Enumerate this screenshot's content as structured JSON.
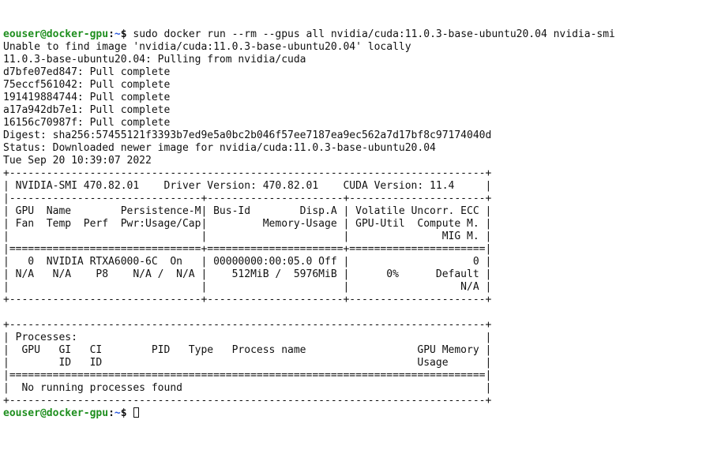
{
  "prompt1": {
    "user": "eouser",
    "at": "@",
    "host": "docker-gpu",
    "colon": ":",
    "path": "~",
    "dollar": "$ ",
    "command": "sudo docker run --rm --gpus all nvidia/cuda:11.0.3-base-ubuntu20.04 nvidia-smi"
  },
  "pull": {
    "l1": "Unable to find image 'nvidia/cuda:11.0.3-base-ubuntu20.04' locally",
    "l2": "11.0.3-base-ubuntu20.04: Pulling from nvidia/cuda",
    "l3": "d7bfe07ed847: Pull complete",
    "l4": "75eccf561042: Pull complete",
    "l5": "191419884744: Pull complete",
    "l6": "a17a942db7e1: Pull complete",
    "l7": "16156c70987f: Pull complete",
    "l8": "Digest: sha256:57455121f3393b7ed9e5a0bc2b046f57ee7187ea9ec562a7d17bf8c97174040d",
    "l9": "Status: Downloaded newer image for nvidia/cuda:11.0.3-base-ubuntu20.04",
    "l10": "Tue Sep 20 10:39:07 2022"
  },
  "smi": {
    "t1": "+-----------------------------------------------------------------------------+",
    "t2": "| NVIDIA-SMI 470.82.01    Driver Version: 470.82.01    CUDA Version: 11.4     |",
    "t3": "|-------------------------------+----------------------+----------------------+",
    "t4": "| GPU  Name        Persistence-M| Bus-Id        Disp.A | Volatile Uncorr. ECC |",
    "t5": "| Fan  Temp  Perf  Pwr:Usage/Cap|         Memory-Usage | GPU-Util  Compute M. |",
    "t6": "|                               |                      |               MIG M. |",
    "t7": "|===============================+======================+======================|",
    "t8": "|   0  NVIDIA RTXA6000-6C  On   | 00000000:00:05.0 Off |                    0 |",
    "t9": "| N/A   N/A    P8    N/A /  N/A |    512MiB /  5976MiB |      0%      Default |",
    "t10": "|                               |                      |                  N/A |",
    "t11": "+-------------------------------+----------------------+----------------------+",
    "blank": "",
    "p1": "+-----------------------------------------------------------------------------+",
    "p2": "| Processes:                                                                  |",
    "p3": "|  GPU   GI   CI        PID   Type   Process name                  GPU Memory |",
    "p4": "|        ID   ID                                                   Usage      |",
    "p5": "|=============================================================================|",
    "p6": "|  No running processes found                                                 |",
    "p7": "+-----------------------------------------------------------------------------+"
  },
  "prompt2": {
    "user": "eouser",
    "at": "@",
    "host": "docker-gpu",
    "colon": ":",
    "path": "~",
    "dollar": "$ "
  },
  "nvidia_smi_data": {
    "smi_version": "470.82.01",
    "driver_version": "470.82.01",
    "cuda_version": "11.4",
    "timestamp": "Tue Sep 20 10:39:07 2022",
    "gpus": [
      {
        "index": 0,
        "name": "NVIDIA RTXA6000-6C",
        "persistence_m": "On",
        "bus_id": "00000000:00:05.0",
        "disp_a": "Off",
        "volatile_uncorr_ecc": "0",
        "fan": "N/A",
        "temp": "N/A",
        "perf": "P8",
        "pwr_usage": "N/A",
        "pwr_cap": "N/A",
        "memory_used_mib": 512,
        "memory_total_mib": 5976,
        "gpu_util_pct": 0,
        "compute_mode": "Default",
        "mig_mode": "N/A"
      }
    ],
    "processes": "No running processes found"
  }
}
